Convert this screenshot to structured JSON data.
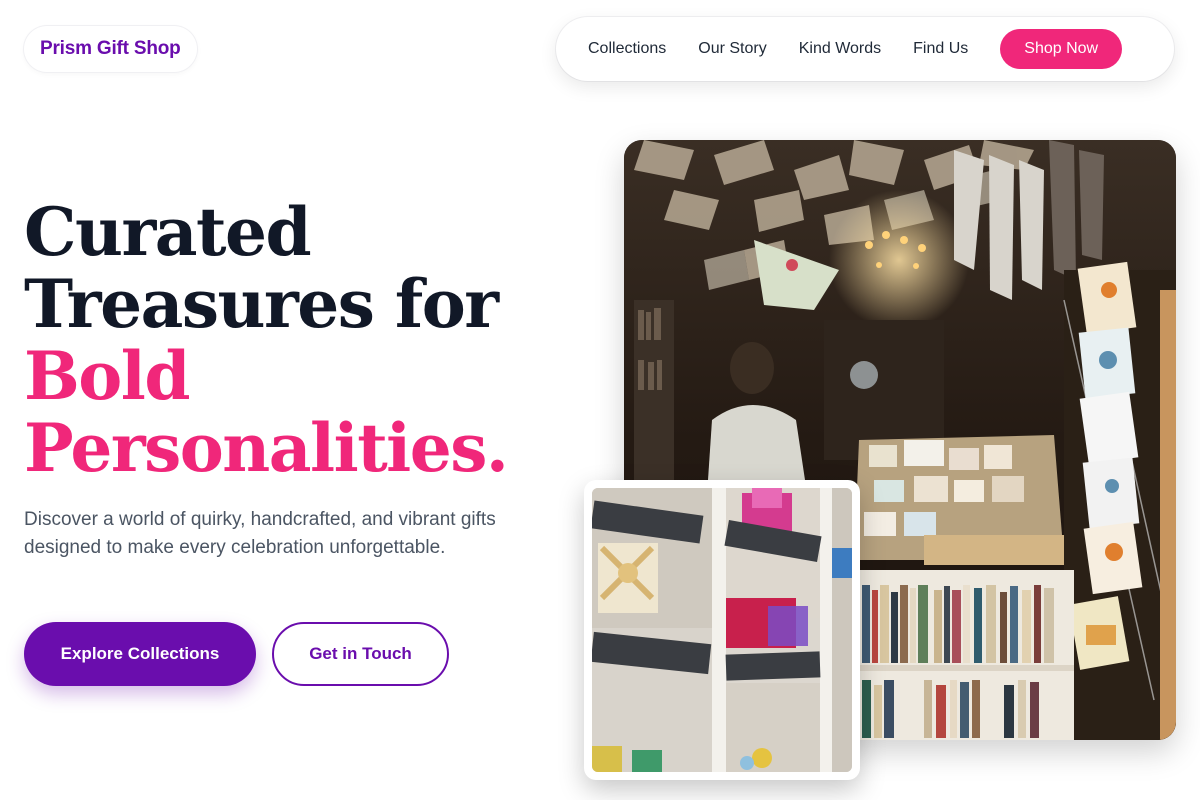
{
  "brand": {
    "name": "Prism Gift Shop"
  },
  "nav": {
    "links": [
      "Collections",
      "Our Story",
      "Kind Words",
      "Find Us"
    ],
    "cta": "Shop Now"
  },
  "hero": {
    "headline_line1": "Curated",
    "headline_line2": "Treasures for",
    "headline_accent1": "Bold",
    "headline_accent2": "Personalities.",
    "lead": "Discover a world of quirky, handcrafted, and vibrant gifts designed to make every celebration unforgettable.",
    "primary_button": "Explore Collections",
    "secondary_button": "Get in Touch"
  },
  "images": {
    "main": "gift-shop-interior-photo",
    "secondary": "gift-shelves-photo"
  },
  "colors": {
    "brand_purple": "#6a0dad",
    "accent_pink": "#f0277a",
    "heading": "#111827",
    "body_text": "#4b5563"
  }
}
